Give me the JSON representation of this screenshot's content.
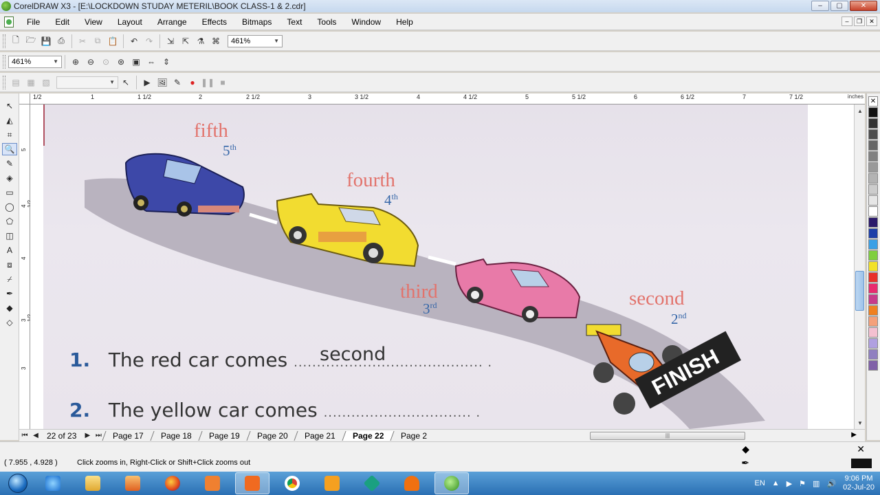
{
  "window": {
    "title": "CorelDRAW X3 - [E:\\LOCKDOWN STUDAY METERIL\\BOOK CLASS-1 & 2.cdr]",
    "controls": [
      "–",
      "▢",
      "✕"
    ]
  },
  "menu": [
    "File",
    "Edit",
    "View",
    "Layout",
    "Arrange",
    "Effects",
    "Bitmaps",
    "Text",
    "Tools",
    "Window",
    "Help"
  ],
  "toolbar1": {
    "zoom_value": "461%"
  },
  "toolbar2": {
    "zoom_value": "461%"
  },
  "toolbar3": {
    "combo_value": ""
  },
  "ruler": {
    "units": "inches",
    "h_labels": [
      "1/2",
      "1",
      "1 1/2",
      "2",
      "2 1/2",
      "3",
      "3 1/2",
      "4",
      "4 1/2",
      "5",
      "5 1/2",
      "6",
      "6 1/2",
      "7",
      "7 1/2"
    ],
    "v_labels": [
      "5",
      "4 1/2",
      "4",
      "3 1/2",
      "3"
    ]
  },
  "page": {
    "ordinals": [
      {
        "word": "fifth",
        "num": "5",
        "suffix": "th"
      },
      {
        "word": "fourth",
        "num": "4",
        "suffix": "th"
      },
      {
        "word": "third",
        "num": "3",
        "suffix": "rd"
      },
      {
        "word": "second",
        "num": "2",
        "suffix": "nd"
      }
    ],
    "finish_label": "FINISH",
    "questions": [
      {
        "num": "1.",
        "text": "The red car comes",
        "answer": "second"
      },
      {
        "num": "2.",
        "text": "The yellow car comes",
        "answer": ""
      }
    ]
  },
  "pagebar": {
    "count": "22 of 23",
    "tabs": [
      "Page 17",
      "Page 18",
      "Page 19",
      "Page 20",
      "Page 21",
      "Page 22",
      "Page 2"
    ],
    "active_tab": "Page 22"
  },
  "status": {
    "coords": "( 7.955 , 4.928 )",
    "hint": "Click zooms in, Right-Click or Shift+Click zooms out"
  },
  "palette": [
    "#ffffff",
    "#111111",
    "#333333",
    "#4d4d4d",
    "#666666",
    "#808080",
    "#999999",
    "#b3b3b3",
    "#cccccc",
    "#e6e6e6",
    "#ffffff",
    "#2b1a6b",
    "#1e3fa8",
    "#3aa0e6",
    "#7fcf3e",
    "#f2e22a",
    "#e8312a",
    "#e82a6e",
    "#c73a8a",
    "#f08020",
    "#f4a07a",
    "#f4c0d0",
    "#b0a0e0",
    "#9080c0",
    "#8060a8"
  ],
  "tray": {
    "lang": "EN",
    "time": "9:06 PM",
    "date": "02-Jul-20"
  },
  "colors": {
    "accent": "#2a6fb3",
    "ordinal_word": "#e2736c",
    "ordinal_num": "#3566a8"
  }
}
